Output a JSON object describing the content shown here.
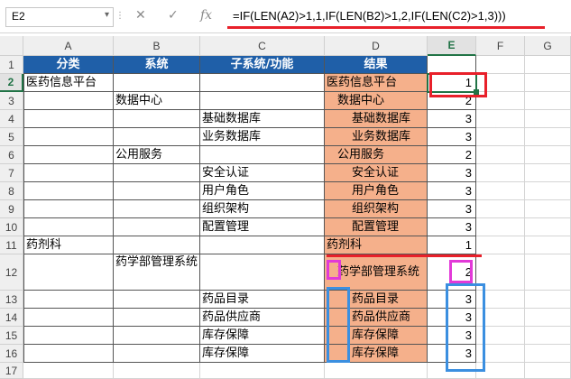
{
  "formula_bar": {
    "name_box": "E2",
    "cancel_icon": "✕",
    "enter_icon": "✓",
    "fx_label": "fx",
    "formula": "=IF(LEN(A2)>1,1,IF(LEN(B2)>1,2,IF(LEN(C2)>1,3)))"
  },
  "columns": [
    "A",
    "B",
    "C",
    "D",
    "E",
    "F",
    "G"
  ],
  "rows": [
    "1",
    "2",
    "3",
    "4",
    "5",
    "6",
    "7",
    "8",
    "9",
    "10",
    "11",
    "12",
    "13",
    "14",
    "15",
    "16",
    "17"
  ],
  "header_row": {
    "a": "分类",
    "b": "系统",
    "c": "子系统/功能",
    "d": "结果"
  },
  "data": [
    {
      "a": "医药信息平台",
      "b": "",
      "c": "",
      "d": "医药信息平台",
      "e": "1"
    },
    {
      "a": "",
      "b": "数据中心",
      "c": "",
      "d": "数据中心",
      "e": "2"
    },
    {
      "a": "",
      "b": "",
      "c": "基础数据库",
      "d": "基础数据库",
      "e": "3"
    },
    {
      "a": "",
      "b": "",
      "c": "业务数据库",
      "d": "业务数据库",
      "e": "3"
    },
    {
      "a": "",
      "b": "公用服务",
      "c": "",
      "d": "公用服务",
      "e": "2"
    },
    {
      "a": "",
      "b": "",
      "c": "安全认证",
      "d": "安全认证",
      "e": "3"
    },
    {
      "a": "",
      "b": "",
      "c": "用户角色",
      "d": "用户角色",
      "e": "3"
    },
    {
      "a": "",
      "b": "",
      "c": "组织架构",
      "d": "组织架构",
      "e": "3"
    },
    {
      "a": "",
      "b": "",
      "c": "配置管理",
      "d": "配置管理",
      "e": "3"
    },
    {
      "a": "药剂科",
      "b": "",
      "c": "",
      "d": "药剂科",
      "e": "1"
    },
    {
      "a": "",
      "b": "药学部管理系统",
      "c": "",
      "d": "药学部管理系统",
      "e": "2"
    },
    {
      "a": "",
      "b": "",
      "c": "药品目录",
      "d": "药品目录",
      "e": "3"
    },
    {
      "a": "",
      "b": "",
      "c": "药品供应商",
      "d": "药品供应商",
      "e": "3"
    },
    {
      "a": "",
      "b": "",
      "c": "库存保障",
      "d": "库存保障",
      "e": "3"
    },
    {
      "a": "",
      "b": "",
      "c": "库存保障",
      "d": "库存保障",
      "e": "3"
    }
  ],
  "colors": {
    "header_blue": "#1f5fa8",
    "result_orange": "#f5b08b",
    "annot_red": "#e8202a",
    "annot_magenta": "#e23ad8",
    "annot_blue": "#3b8fe0",
    "excel_green": "#217346"
  }
}
